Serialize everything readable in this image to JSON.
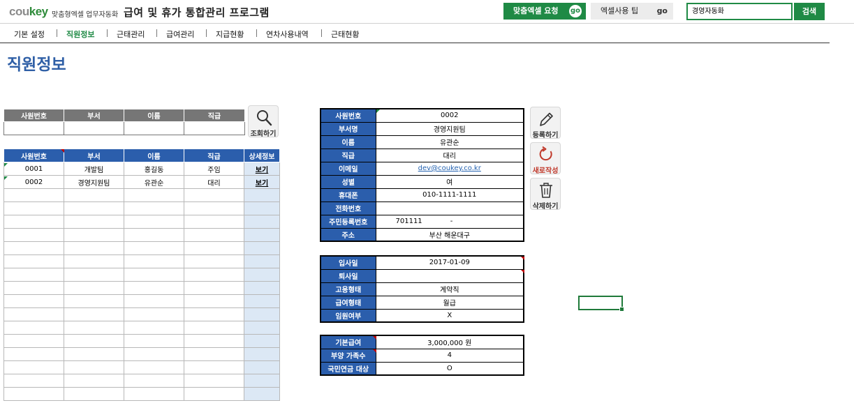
{
  "header": {
    "brand": "cou",
    "brand_y": "key",
    "brand_sub": "맞춤형엑셀 업무자동화",
    "app_title": "급여 및 휴가 통합관리 프로그램",
    "request_label": "맞춤엑셀 요청",
    "request_go": "go",
    "tips_label": "엑셀사용 팁",
    "tips_go": "go",
    "search_value": "경영자동화",
    "search_button": "검색"
  },
  "menu": [
    "기본 설정",
    "직원정보",
    "근태관리",
    "급여관리",
    "지급현황",
    "연차사용내역",
    "근태현황"
  ],
  "active_menu": "직원정보",
  "page_title": "직원정보",
  "search_form": {
    "columns": [
      "사원번호",
      "부서",
      "이름",
      "직급"
    ],
    "values": [
      "",
      "",
      "",
      ""
    ],
    "button": "조회하기"
  },
  "employee_list": {
    "columns": [
      "사원번호",
      "부서",
      "이름",
      "직급",
      "상세정보"
    ],
    "rows": [
      [
        "0001",
        "개발팀",
        "홍길동",
        "주임",
        "보기"
      ],
      [
        "0002",
        "경영지원팀",
        "유관순",
        "대리",
        "보기"
      ]
    ],
    "empty_rows": 16
  },
  "detail": {
    "basic": [
      {
        "label": "사원번호",
        "value": "0002"
      },
      {
        "label": "부서명",
        "value": "경영지원팀"
      },
      {
        "label": "이름",
        "value": "유관순"
      },
      {
        "label": "직급",
        "value": "대리"
      },
      {
        "label": "이메일",
        "value": "dev@coukey.co.kr"
      },
      {
        "label": "성별",
        "value": "여"
      },
      {
        "label": "휴대폰",
        "value": "010-1111-1111"
      },
      {
        "label": "전화번호",
        "value": ""
      },
      {
        "label": "주민등록번호",
        "value": "701111",
        "value2": "-"
      },
      {
        "label": "주소",
        "value": "부산 해운대구"
      }
    ],
    "employment": [
      {
        "label": "입사일",
        "value": "2017-01-09"
      },
      {
        "label": "퇴사일",
        "value": ""
      },
      {
        "label": "고용형태",
        "value": "계약직"
      },
      {
        "label": "급여형태",
        "value": "월급"
      },
      {
        "label": "임원여부",
        "value": "X"
      }
    ],
    "salary": [
      {
        "label": "기본급여",
        "value": "3,000,000 원"
      },
      {
        "label": "부양 가족수",
        "value": "4"
      },
      {
        "label": "국민연금 대상",
        "value": "O"
      }
    ]
  },
  "actions": {
    "register": "등록하기",
    "new": "새로작성",
    "delete": "삭제하기"
  },
  "colors": {
    "brand_green": "#1f8a45",
    "header_blue": "#2b5eac",
    "title_blue": "#2f5fa6",
    "new_red": "#c0392b"
  },
  "icons": [
    "search-icon",
    "pencil-icon",
    "refresh-icon",
    "trash-icon"
  ]
}
